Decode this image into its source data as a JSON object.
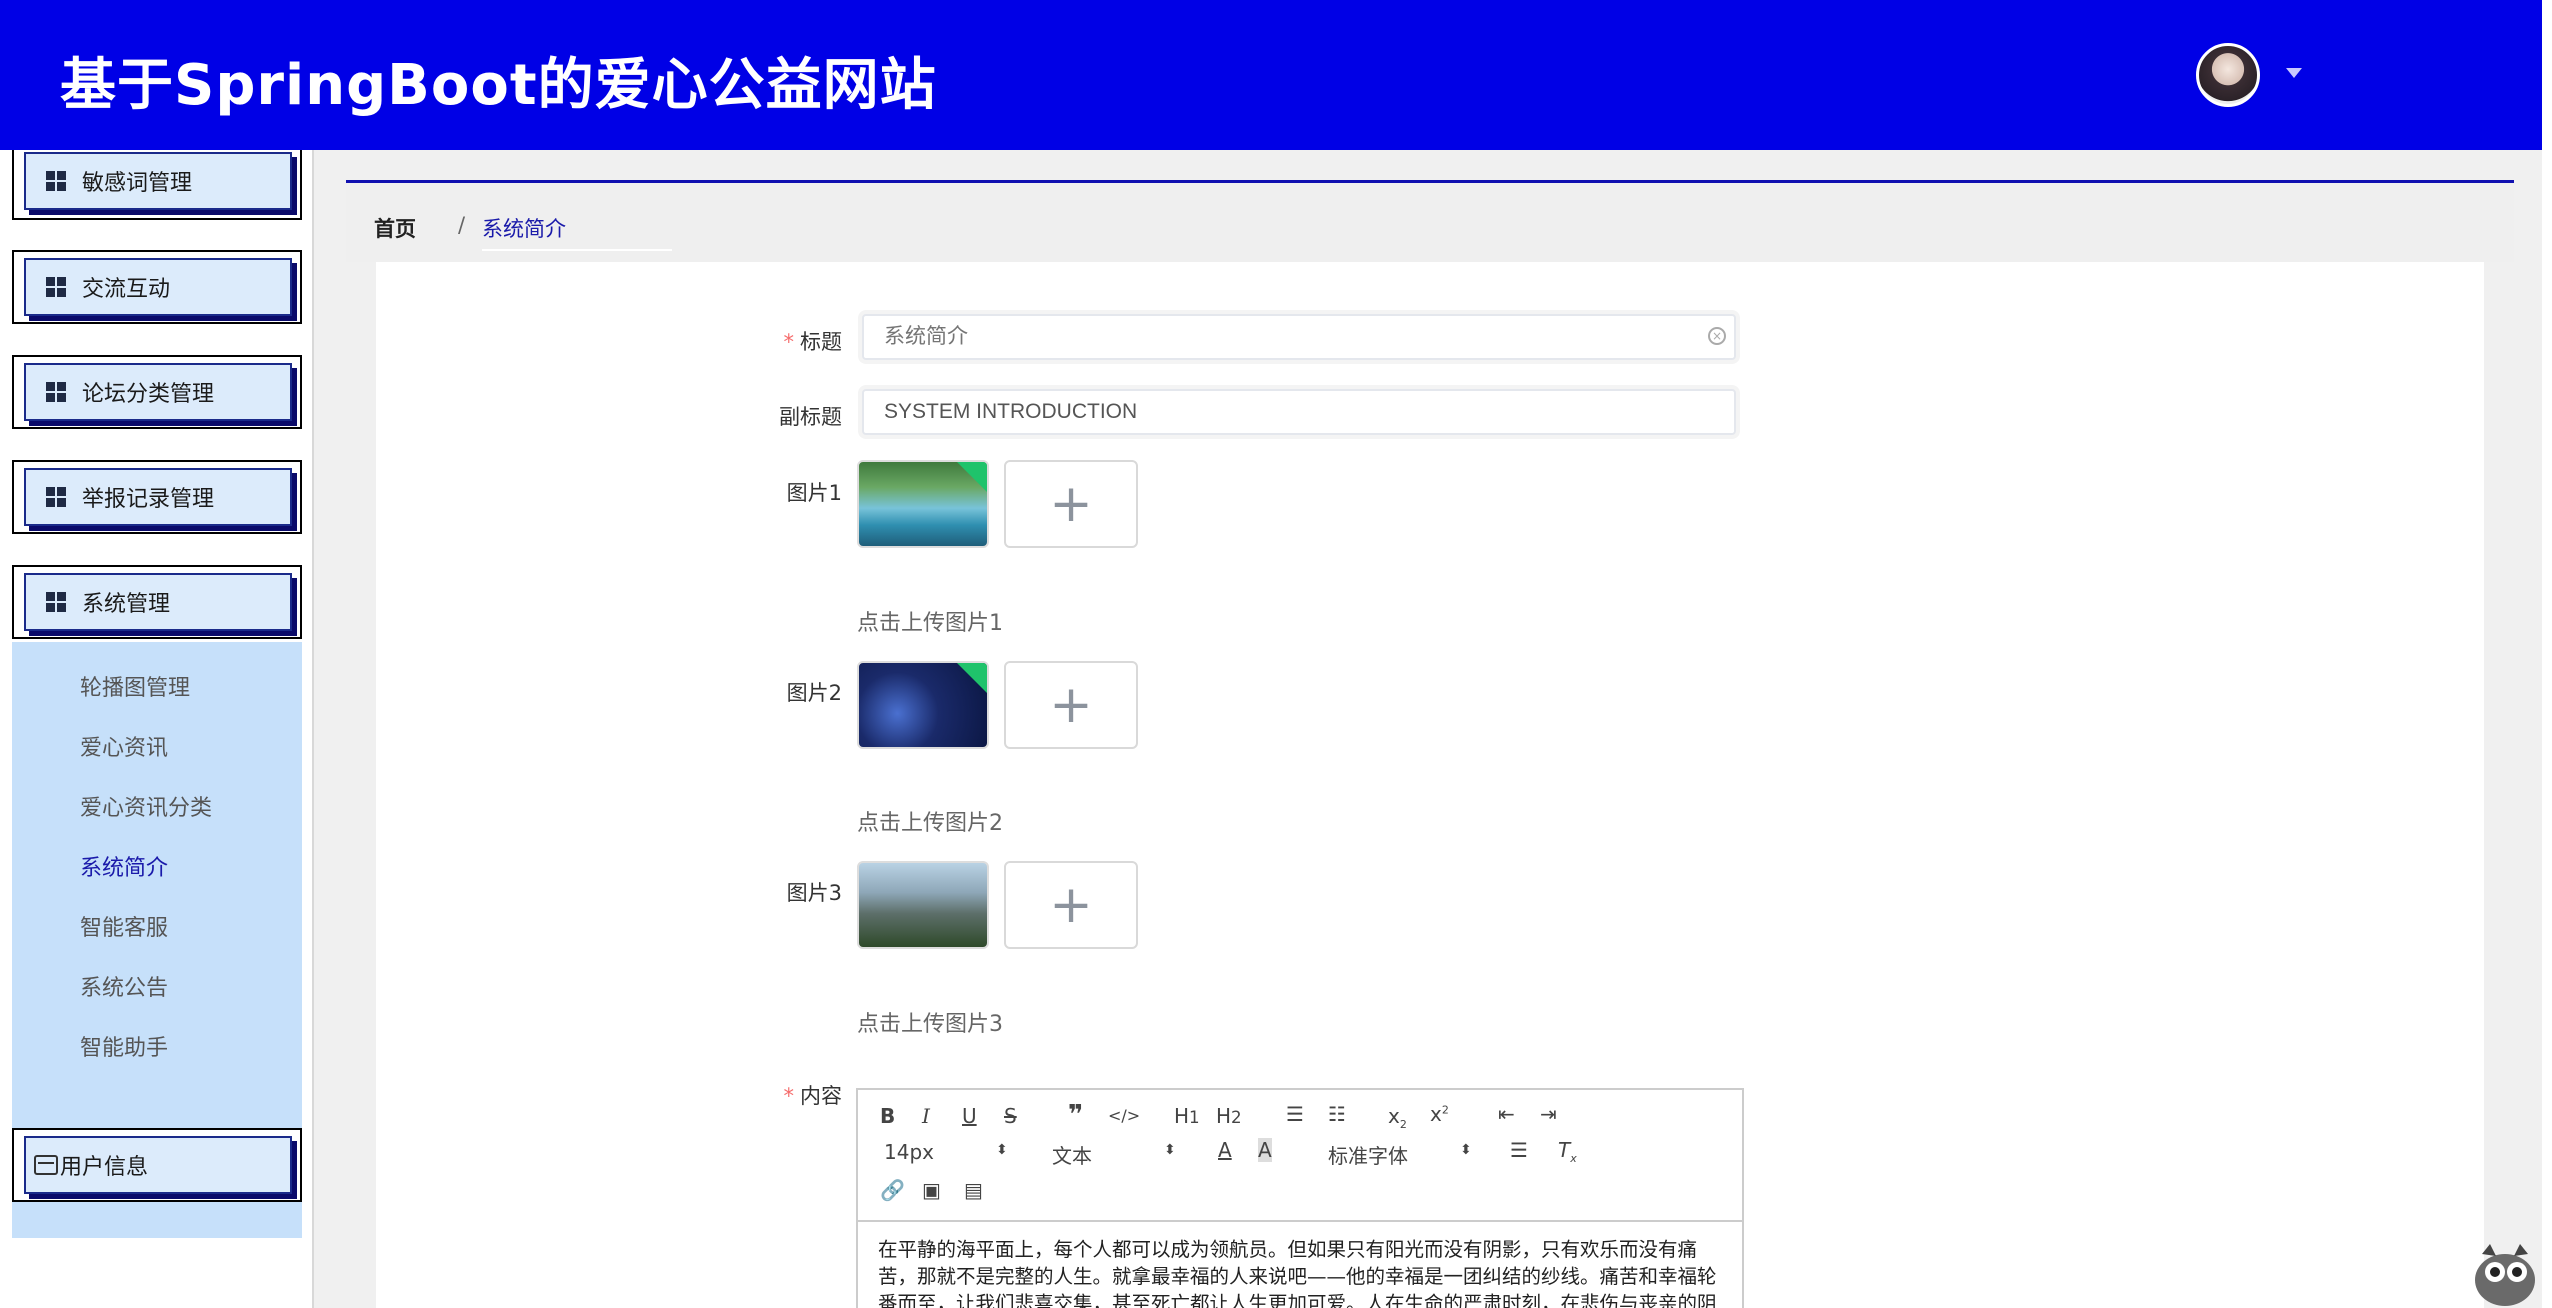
{
  "header": {
    "title": "基于SpringBoot的爱心公益网站"
  },
  "sidebar": {
    "groups": [
      {
        "label": "敏感词管理"
      },
      {
        "label": "交流互动"
      },
      {
        "label": "论坛分类管理"
      },
      {
        "label": "举报记录管理"
      },
      {
        "label": "系统管理"
      }
    ],
    "submenu": [
      {
        "label": "轮播图管理"
      },
      {
        "label": "爱心资讯"
      },
      {
        "label": "爱心资讯分类"
      },
      {
        "label": "系统简介"
      },
      {
        "label": "智能客服"
      },
      {
        "label": "系统公告"
      },
      {
        "label": "智能助手"
      }
    ],
    "user_info": "用户信息"
  },
  "breadcrumb": {
    "home": "首页",
    "separator": "/",
    "current": "系统简介"
  },
  "form": {
    "title_label": "标题",
    "title_placeholder": "系统简介",
    "subtitle_label": "副标题",
    "subtitle_value": "SYSTEM INTRODUCTION",
    "image1_label": "图片1",
    "image1_hint": "点击上传图片1",
    "image2_label": "图片2",
    "image2_hint": "点击上传图片2",
    "image3_label": "图片3",
    "image3_hint": "点击上传图片3",
    "content_label": "内容",
    "required_mark": "*"
  },
  "editor": {
    "font_size": "14px",
    "block_type": "文本",
    "font_family": "标准字体",
    "content_line1": "在平静的海平面上，每个人都可以成为领航员。但如果只有阳光而没有阴影，只有欢乐而没有痛",
    "content_line2": "苦，那就不是完整的人生。就拿最幸福的人来说吧——他的幸福是一团纠结的纱线。痛苦和幸福轮",
    "content_line3": "番而至，让我们悲喜交集，甚至死亡都让人生更加可爱。人在生命的严肃时刻，在悲伤与丧亲的阴"
  },
  "colors": {
    "header_bg": "#0000e6",
    "menu_btn_bg": "#dcebfb",
    "submenu_bg": "#c6e0fa",
    "active_link": "#1a1aaa",
    "required": "#f56c6c"
  }
}
